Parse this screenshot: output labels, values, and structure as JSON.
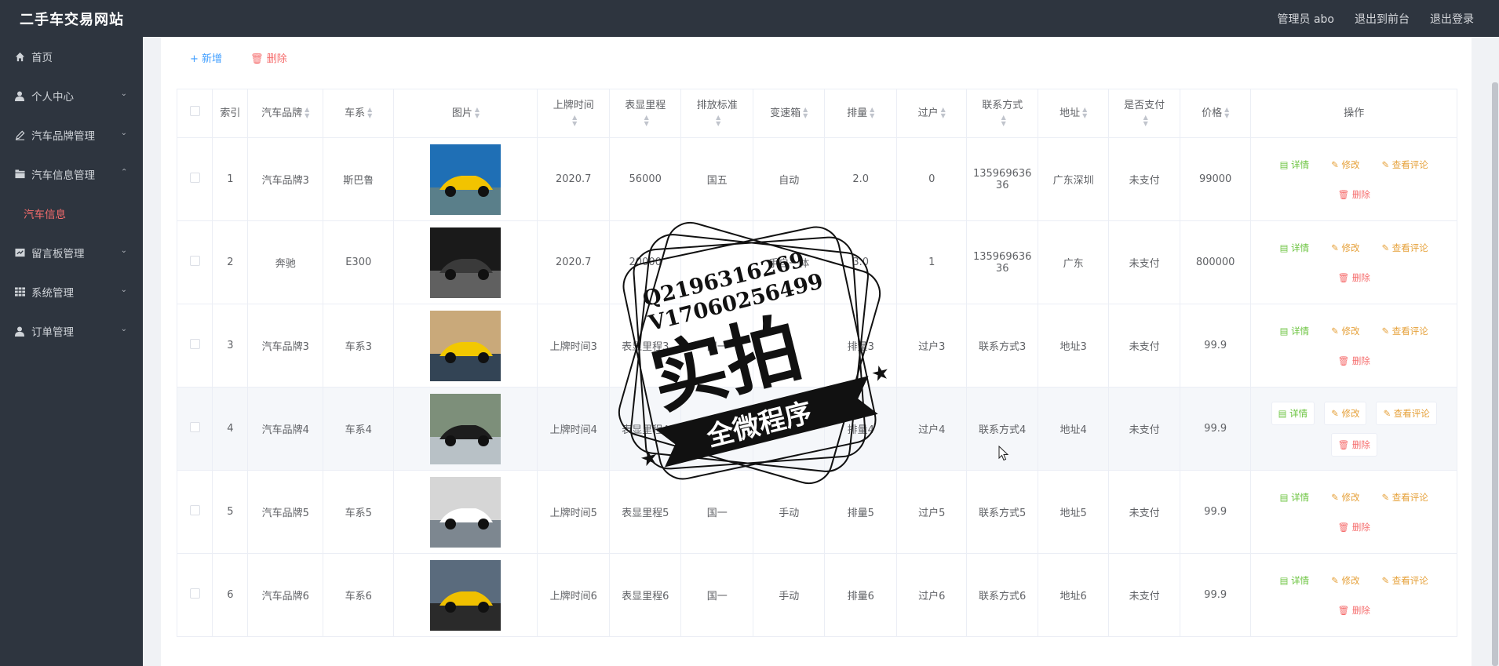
{
  "app": {
    "title": "二手车交易网站"
  },
  "header": {
    "admin_label": "管理员 abo",
    "to_front_label": "退出到前台",
    "logout_label": "退出登录"
  },
  "sidebar": {
    "items": [
      {
        "label": "首页",
        "icon": "home-icon"
      },
      {
        "label": "个人中心",
        "icon": "user-icon"
      },
      {
        "label": "汽车品牌管理",
        "icon": "pen-icon"
      },
      {
        "label": "汽车信息管理",
        "icon": "folder-icon"
      },
      {
        "label": "留言板管理",
        "icon": "board-icon"
      },
      {
        "label": "系统管理",
        "icon": "grid-icon"
      },
      {
        "label": "订单管理",
        "icon": "user-icon"
      }
    ],
    "active_sub": "汽车信息"
  },
  "toolbar": {
    "add_label": "+ 新增",
    "delete_label": "删除"
  },
  "table": {
    "headers": [
      "索引",
      "汽车品牌",
      "车系",
      "图片",
      "上牌时间",
      "表显里程",
      "排放标准",
      "变速箱",
      "排量",
      "过户",
      "联系方式",
      "地址",
      "是否支付",
      "价格",
      "操作"
    ],
    "actions": {
      "detail": "详情",
      "edit": "修改",
      "review": "查看评论",
      "delete": "删除"
    },
    "rows": [
      {
        "idx": "1",
        "brand": "汽车品牌3",
        "series": "斯巴鲁",
        "date": "2020.7",
        "mileage": "56000",
        "emission": "国五",
        "gearbox": "自动",
        "displacement": "2.0",
        "transfer": "0",
        "contact": "135969636 36",
        "address": "广东深圳",
        "paid": "未支付",
        "price": "99000"
      },
      {
        "idx": "2",
        "brand": "奔驰",
        "series": "E300",
        "date": "2020.7",
        "mileage": "20000",
        "emission": "",
        "gearbox": "手自一体",
        "displacement": "3.0",
        "transfer": "1",
        "contact": "135969636 36",
        "address": "广东",
        "paid": "未支付",
        "price": "800000"
      },
      {
        "idx": "3",
        "brand": "汽车品牌3",
        "series": "车系3",
        "date": "上牌时间3",
        "mileage": "表显里程3",
        "emission": "国一",
        "gearbox": "",
        "displacement": "排量3",
        "transfer": "过户3",
        "contact": "联系方式3",
        "address": "地址3",
        "paid": "未支付",
        "price": "99.9"
      },
      {
        "idx": "4",
        "brand": "汽车品牌4",
        "series": "车系4",
        "date": "上牌时间4",
        "mileage": "表显里程4",
        "emission": "",
        "gearbox": "",
        "displacement": "排量4",
        "transfer": "过户4",
        "contact": "联系方式4",
        "address": "地址4",
        "paid": "未支付",
        "price": "99.9"
      },
      {
        "idx": "5",
        "brand": "汽车品牌5",
        "series": "车系5",
        "date": "上牌时间5",
        "mileage": "表显里程5",
        "emission": "国一",
        "gearbox": "手动",
        "displacement": "排量5",
        "transfer": "过户5",
        "contact": "联系方式5",
        "address": "地址5",
        "paid": "未支付",
        "price": "99.9"
      },
      {
        "idx": "6",
        "brand": "汽车品牌6",
        "series": "车系6",
        "date": "上牌时间6",
        "mileage": "表显里程6",
        "emission": "国一",
        "gearbox": "手动",
        "displacement": "排量6",
        "transfer": "过户6",
        "contact": "联系方式6",
        "address": "地址6",
        "paid": "未支付",
        "price": "99.9"
      }
    ]
  },
  "watermark": {
    "line1": "Q2196316269",
    "line2": "V17060256499",
    "big": "实拍",
    "banner": "全微程序"
  }
}
